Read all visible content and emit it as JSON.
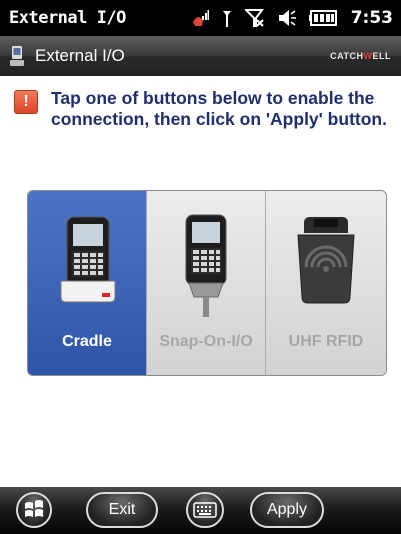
{
  "status_bar": {
    "title": "External I/O",
    "time": "7:53"
  },
  "title_bar": {
    "app_title": "External I/O",
    "brand_main": "CATCH",
    "brand_accent": "W",
    "brand_end": "ELL"
  },
  "notice": {
    "icon_glyph": "!",
    "text": "Tap one of buttons below to enable the connection, then click on 'Apply' button."
  },
  "options": [
    {
      "label": "Cradle",
      "selected": true
    },
    {
      "label": "Snap-On-I/O",
      "selected": false
    },
    {
      "label": "UHF RFID",
      "selected": false
    }
  ],
  "softkeys": {
    "exit": "Exit",
    "apply": "Apply"
  },
  "colors": {
    "accent": "#2e55a8",
    "notice_text": "#1f2f6b",
    "warning": "#d9452b",
    "brand_accent": "#e03a2e"
  },
  "icons": [
    "signal-icon",
    "antenna-icon",
    "no-network-icon",
    "speaker-icon",
    "battery-icon",
    "windows-start-icon",
    "keyboard-icon"
  ]
}
